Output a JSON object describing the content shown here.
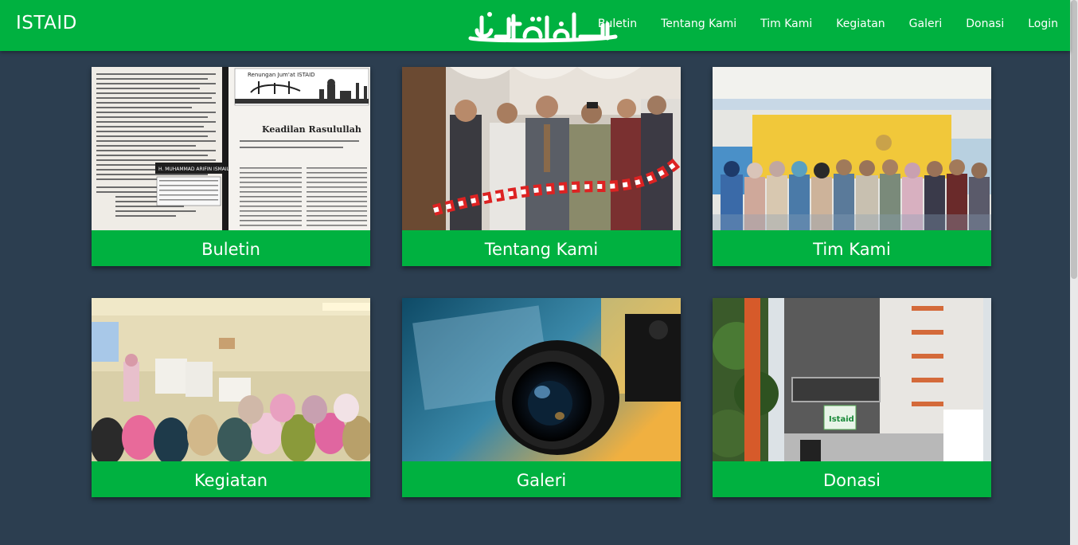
{
  "brand": {
    "name": "ISTAID",
    "logo_text": "Istaid"
  },
  "nav": {
    "items": [
      {
        "label": "Buletin"
      },
      {
        "label": "Tentang Kami"
      },
      {
        "label": "Tim Kami"
      },
      {
        "label": "Kegiatan"
      },
      {
        "label": "Galeri"
      },
      {
        "label": "Donasi"
      },
      {
        "label": "Login"
      }
    ]
  },
  "cards": [
    {
      "label": "Buletin"
    },
    {
      "label": "Tentang Kami"
    },
    {
      "label": "Tim Kami"
    },
    {
      "label": "Kegiatan"
    },
    {
      "label": "Galeri"
    },
    {
      "label": "Donasi"
    }
  ],
  "buletin_image": {
    "header": "Renungan Jum'at ISTAID",
    "title": "Keadilan Rasulullah",
    "author": "H. MUHAMMAD ARIFIN ISMAIL"
  },
  "colors": {
    "brand_green": "#00b140",
    "background": "#2c3e50"
  }
}
